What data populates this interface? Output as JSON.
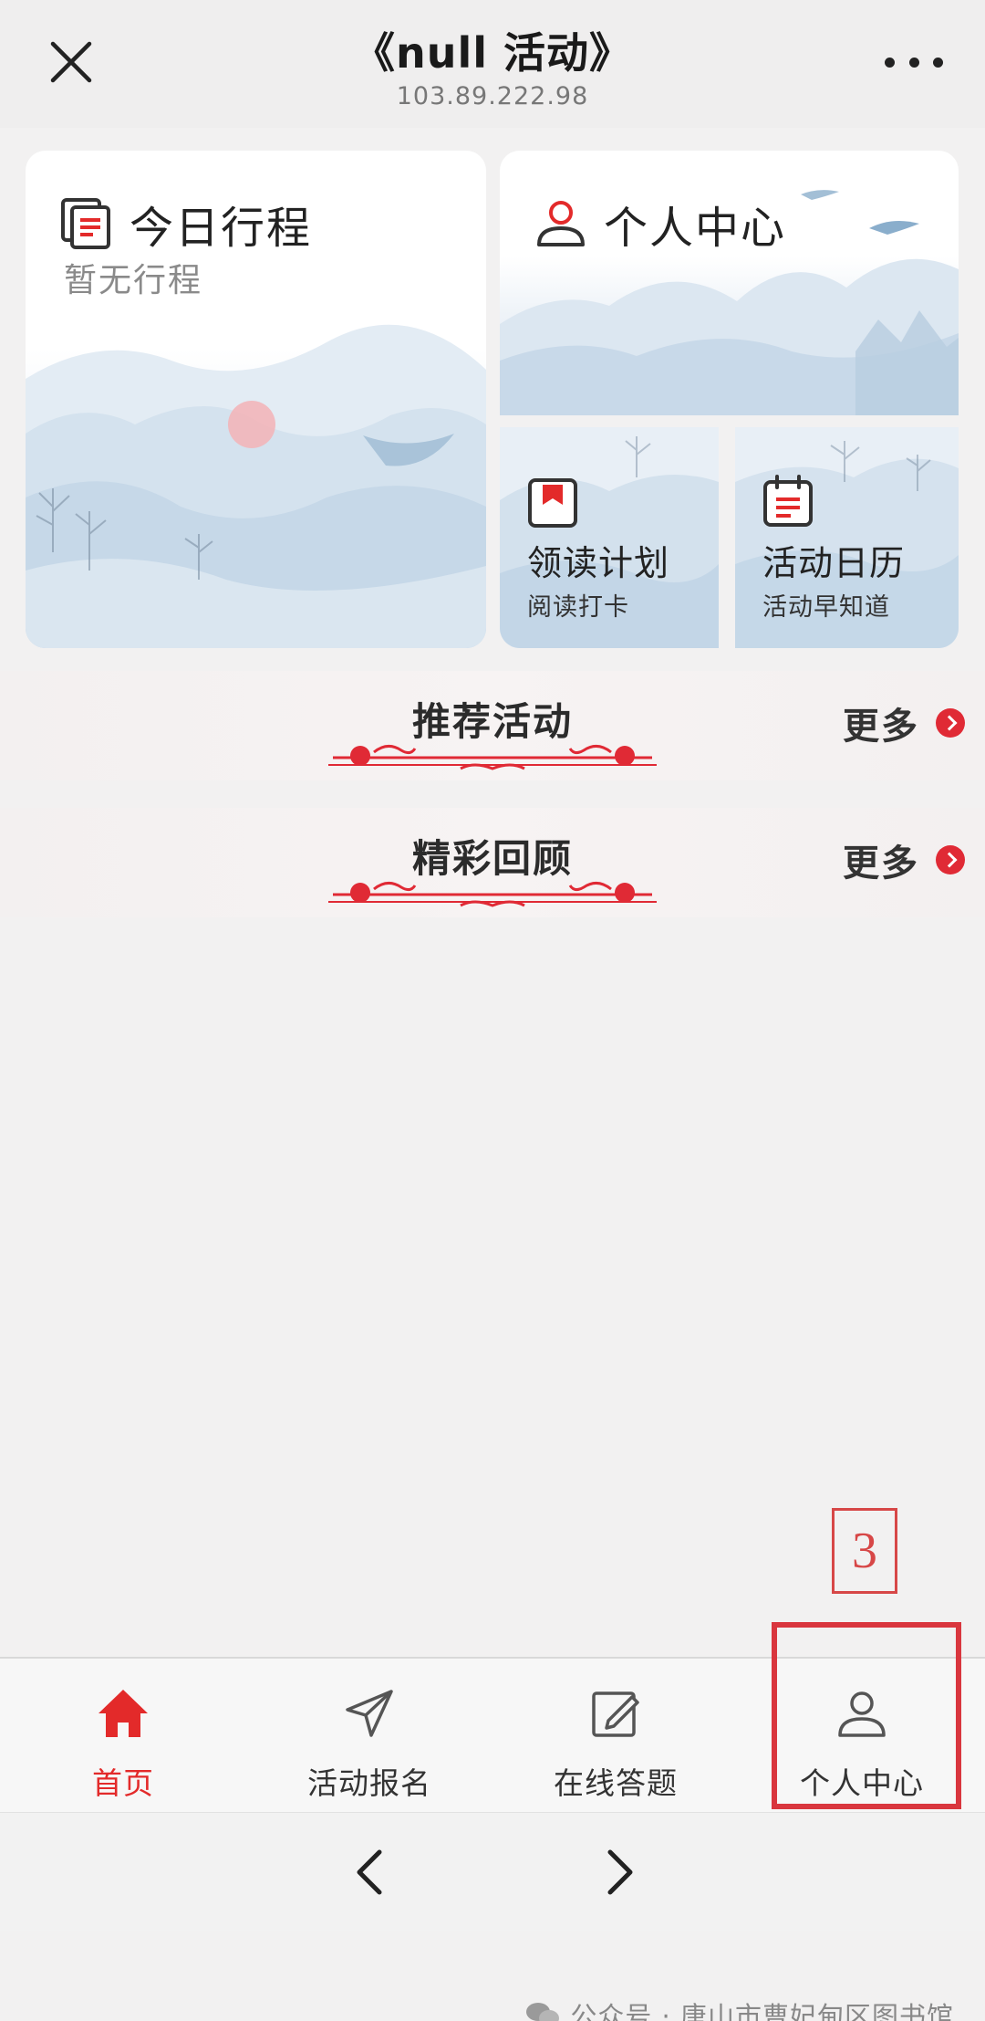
{
  "header": {
    "title": "《null 活动》",
    "subtitle": "103.89.222.98"
  },
  "cards": {
    "schedule": {
      "title": "今日行程",
      "subtitle": "暂无行程"
    },
    "personal": {
      "title": "个人中心"
    },
    "reading": {
      "title": "领读计划",
      "subtitle": "阅读打卡"
    },
    "calendar": {
      "title": "活动日历",
      "subtitle": "活动早知道"
    }
  },
  "sections": [
    {
      "title": "推荐活动",
      "more": "更多"
    },
    {
      "title": "精彩回顾",
      "more": "更多"
    }
  ],
  "annotation": {
    "number": "3"
  },
  "tabbar": {
    "items": [
      {
        "label": "首页",
        "icon": "home-icon",
        "active": true
      },
      {
        "label": "活动报名",
        "icon": "send-icon",
        "active": false
      },
      {
        "label": "在线答题",
        "icon": "edit-icon",
        "active": false
      },
      {
        "label": "个人中心",
        "icon": "user-icon",
        "active": false
      }
    ]
  },
  "watermark": "公众号 · 唐山市曹妃甸区图书馆",
  "colors": {
    "accent": "#e32a2a",
    "annotation": "#d9363e"
  }
}
